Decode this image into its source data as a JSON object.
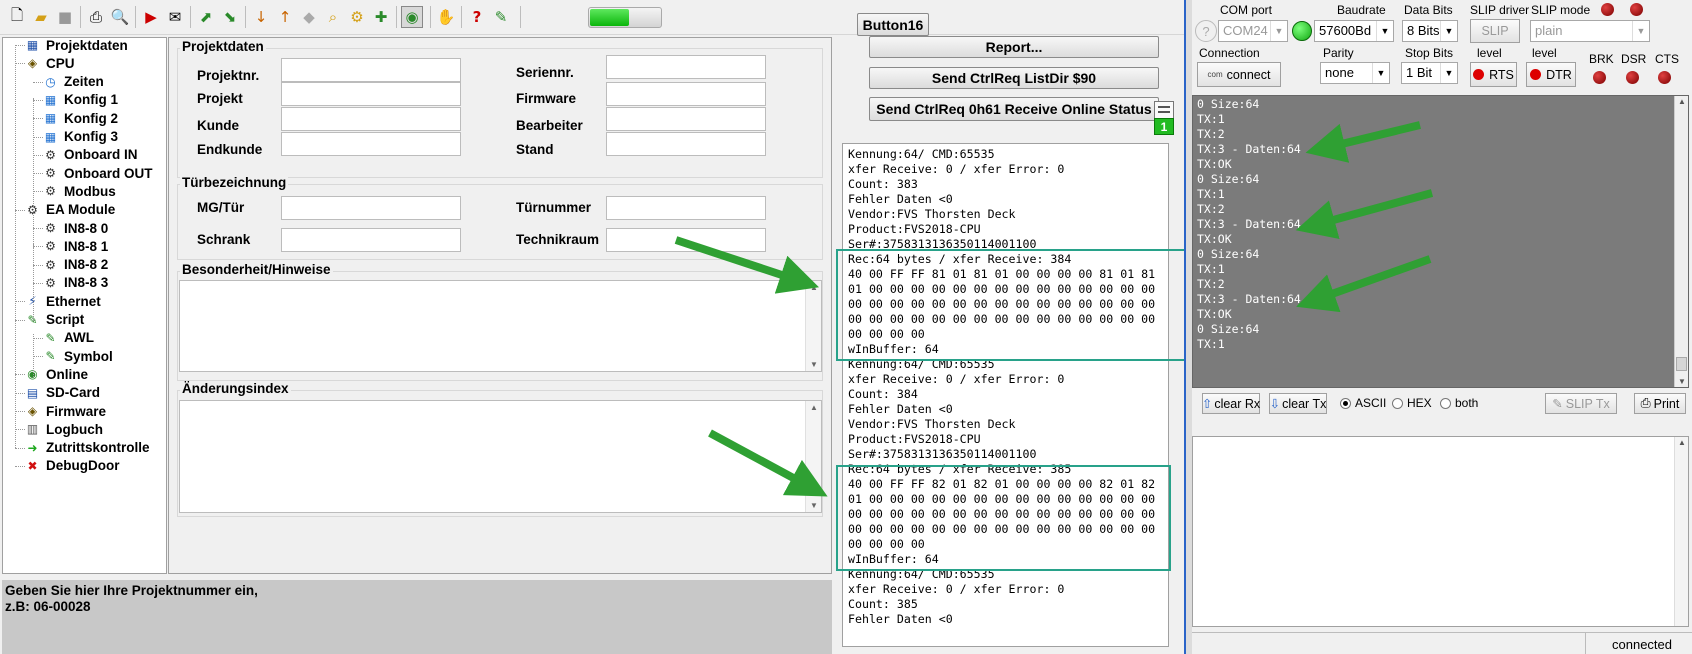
{
  "toolbar": {
    "icons": [
      "new-file",
      "open-folder",
      "save",
      "print",
      "print-preview",
      "export",
      "mail",
      "tool-1",
      "tool-2",
      "sort-down",
      "sort-up",
      "tool-3",
      "search",
      "tool-4",
      "add",
      "monitor-active",
      "hand",
      "help",
      "tool-5"
    ],
    "progress_fraction": 0.55
  },
  "buttons": {
    "button16": "Button16",
    "report": "Report...",
    "ctrlreq_listdir": "Send CtrlReq ListDir $90",
    "ctrlreq_online": "Send CtrlReq 0h61 Receive Online Status",
    "badge": "1"
  },
  "tree": [
    {
      "label": "Projektdaten",
      "icon": "table-icon",
      "level": 0
    },
    {
      "label": "CPU",
      "icon": "chip-icon",
      "level": 0
    },
    {
      "label": "Zeiten",
      "icon": "clock-icon",
      "level": 1
    },
    {
      "label": "Konfig 1",
      "icon": "grid-icon",
      "level": 1
    },
    {
      "label": "Konfig 2",
      "icon": "grid-icon",
      "level": 1
    },
    {
      "label": "Konfig 3",
      "icon": "grid-icon",
      "level": 1
    },
    {
      "label": "Onboard IN",
      "icon": "gear-icon",
      "level": 1
    },
    {
      "label": "Onboard OUT",
      "icon": "gear-icon",
      "level": 1
    },
    {
      "label": "Modbus",
      "icon": "gear-icon",
      "level": 1
    },
    {
      "label": "EA Module",
      "icon": "gear-icon",
      "level": 0
    },
    {
      "label": "IN8-8 0",
      "icon": "gear-icon",
      "level": 1
    },
    {
      "label": "IN8-8 1",
      "icon": "gear-icon",
      "level": 1
    },
    {
      "label": "IN8-8 2",
      "icon": "gear-icon",
      "level": 1
    },
    {
      "label": "IN8-8 3",
      "icon": "gear-icon",
      "level": 1
    },
    {
      "label": "Ethernet",
      "icon": "network-icon",
      "level": 0
    },
    {
      "label": "Script",
      "icon": "script-icon",
      "level": 0
    },
    {
      "label": "AWL",
      "icon": "script-icon",
      "level": 1
    },
    {
      "label": "Symbol",
      "icon": "script-icon",
      "level": 1
    },
    {
      "label": "Online",
      "icon": "globe-icon",
      "level": 0
    },
    {
      "label": "SD-Card",
      "icon": "sdcard-icon",
      "level": 0
    },
    {
      "label": "Firmware",
      "icon": "chip-icon",
      "level": 0
    },
    {
      "label": "Logbuch",
      "icon": "book-icon",
      "level": 0
    },
    {
      "label": "Zutrittskontrolle",
      "icon": "green-arrow-icon",
      "level": 0
    },
    {
      "label": "DebugDoor",
      "icon": "red-x-icon",
      "level": 0
    }
  ],
  "form": {
    "group_projekt": "Projektdaten",
    "projektnr": "Projektnr.",
    "projekt": "Projekt",
    "kunde": "Kunde",
    "endkunde": "Endkunde",
    "seriennr": "Seriennr.",
    "firmware": "Firmware",
    "bearbeiter": "Bearbeiter",
    "stand": "Stand",
    "group_tuer": "Türbezeichnung",
    "mg_tuer": "MG/Tür",
    "schrank": "Schrank",
    "tuernummer": "Türnummer",
    "technikraum": "Technikraum",
    "besonderheit": "Besonderheit/Hinweise",
    "aenderung": "Änderungsindex"
  },
  "status": {
    "line1": "Geben Sie hier Ihre Projektnummer ein,",
    "line2": "z.B: 06-00028"
  },
  "log_lines": [
    "Kennung:64/ CMD:65535",
    "xfer Receive: 0 / xfer Error: 0",
    "Count: 383",
    "Fehler Daten <0",
    "Vendor:FVS Thorsten Deck",
    "Product:FVS2018-CPU",
    "Ser#:375831313635011400110​0",
    "Rec:64 bytes / xfer Receive: 384",
    "40 00 FF FF 81 01 81 01 00 00 00 00 81 01 81",
    "01 00 00 00 00 00 00 00 00 00 00 00 00 00 00",
    "00 00 00 00 00 00 00 00 00 00 00 00 00 00 00",
    "00 00 00 00 00 00 00 00 00 00 00 00 00 00 00",
    "00 00 00 00",
    "wInBuffer: 64",
    "Kennung:64/ CMD:65535",
    "xfer Receive: 0 / xfer Error: 0",
    "Count: 384",
    "Fehler Daten <0",
    "Vendor:FVS Thorsten Deck",
    "Product:FVS2018-CPU",
    "Ser#:375831313635011400110​0",
    "Rec:64 bytes / xfer Receive: 385",
    "40 00 FF FF 82 01 82 01 00 00 00 00 82 01 82",
    "01 00 00 00 00 00 00 00 00 00 00 00 00 00 00",
    "00 00 00 00 00 00 00 00 00 00 00 00 00 00 00",
    "00 00 00 00 00 00 00 00 00 00 00 00 00 00 00",
    "00 00 00 00",
    "wInBuffer: 64",
    "Kennung:64/ CMD:65535",
    "xfer Receive: 0 / xfer Error: 0",
    "Count: 385",
    "Fehler Daten <0"
  ],
  "serial": {
    "com_port_label": "COM port",
    "com_port_value": "COM24",
    "baudrate_label": "Baudrate",
    "baudrate_value": "57600Bd",
    "databits_label": "Data Bits",
    "databits_value": "8 Bits",
    "slip_driver_label": "SLIP driver",
    "slip_button": "SLIP",
    "slip_mode_label": "SLIP mode",
    "slip_mode_value": "plain",
    "connection_label": "Connection",
    "connect_button": "connect",
    "connect_icon_text": "com",
    "parity_label": "Parity",
    "parity_value": "none",
    "stopbits_label": "Stop Bits",
    "stopbits_value": "1 Bit",
    "level1_label": "level",
    "rts_button": "RTS",
    "level2_label": "level",
    "dtr_button": "DTR",
    "brk_label": "BRK",
    "dsr_label": "DSR",
    "cts_label": "CTS",
    "help": "?"
  },
  "terminal_lines": [
    "0 Size:64",
    "TX:1",
    "TX:2",
    "TX:3 - Daten:64",
    "TX:OK",
    "0 Size:64",
    "TX:1",
    "TX:2",
    "TX:3 - Daten:64",
    "TX:OK",
    "0 Size:64",
    "TX:1",
    "TX:2",
    "TX:3 - Daten:64",
    "TX:OK",
    "0 Size:64",
    "TX:1"
  ],
  "controls": {
    "clear_rx": "clear Rx",
    "clear_tx": "clear Tx",
    "ascii": "ASCII",
    "hex": "HEX",
    "both": "both",
    "slip_tx": "SLIP Tx",
    "print": "Print",
    "selected_mode": "ASCII"
  },
  "statusbar": {
    "state": "connected"
  },
  "colors": {
    "highlight": "#28a28a",
    "arrow": "#2fa033",
    "led_on": "#22cc22",
    "led_off": "#b00000"
  }
}
